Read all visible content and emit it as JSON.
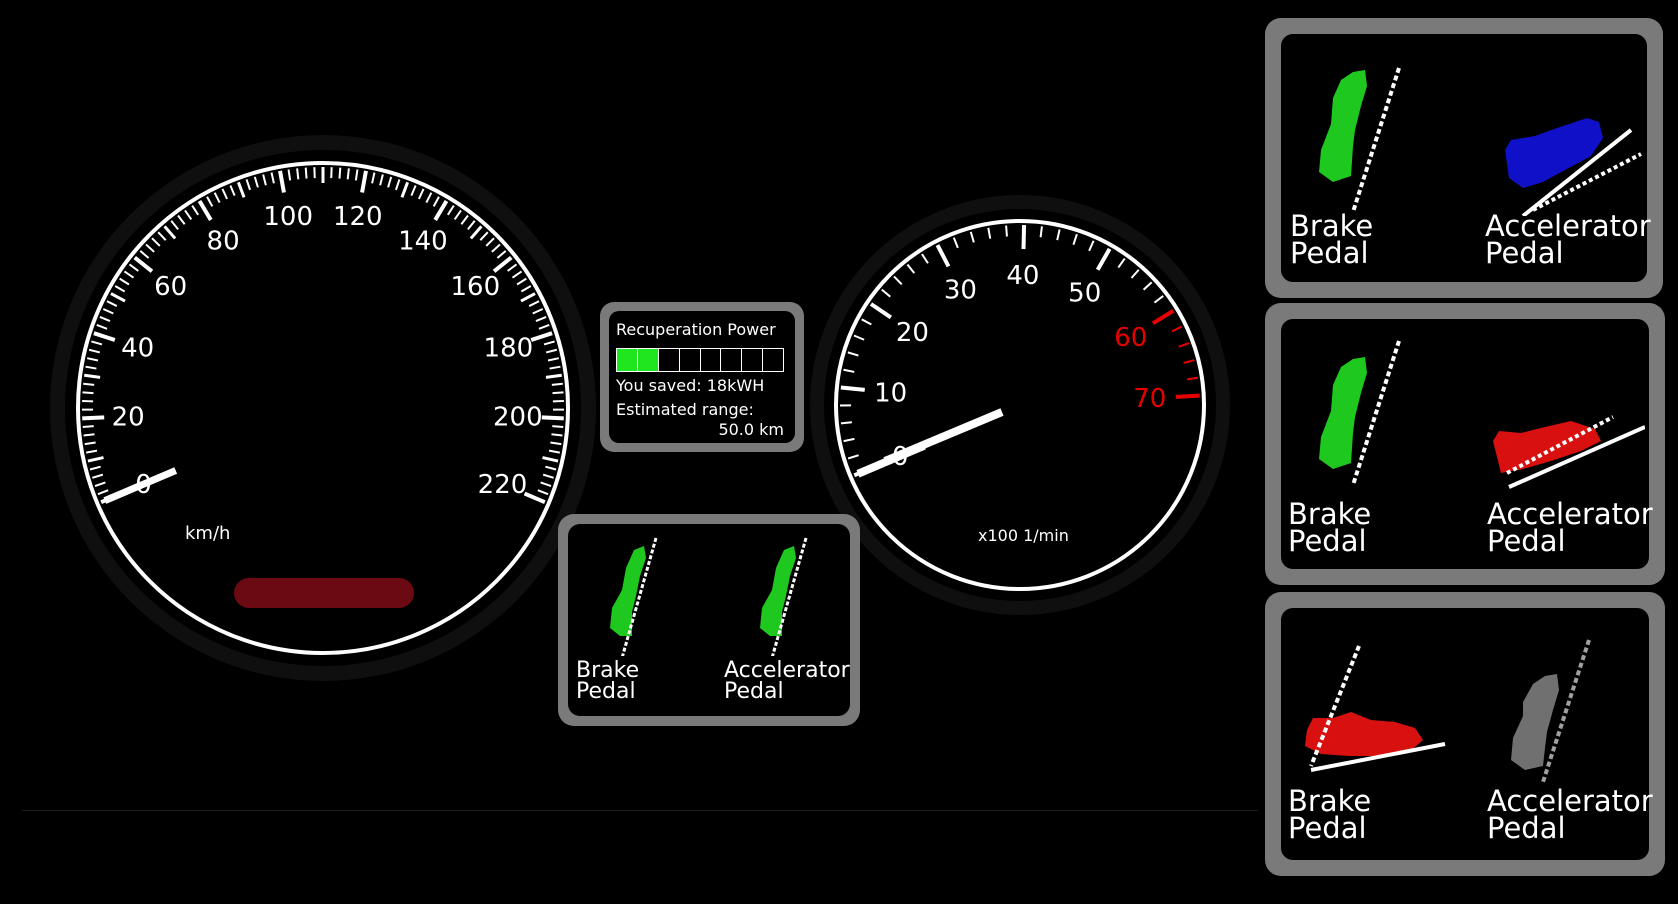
{
  "speedometer": {
    "unit": "km/h",
    "tick_labels": [
      "0",
      "20",
      "40",
      "60",
      "80",
      "100",
      "120",
      "140",
      "160",
      "180",
      "200",
      "220"
    ],
    "value": 0,
    "indicator_color": "#6b0a12"
  },
  "tachometer": {
    "unit": "x100 1/min",
    "tick_labels": [
      "0",
      "10",
      "20",
      "30",
      "40",
      "50",
      "60",
      "70"
    ],
    "redline_labels_color": "#e60000",
    "value": 0
  },
  "recuperation": {
    "title": "Recuperation Power",
    "bar_segments_total": 8,
    "bar_segments_filled": 2,
    "bar_color": "#1fe61f",
    "saved_text": "You saved: 18kWH",
    "range_label": "Estimated range:",
    "range_value": "50.0 km"
  },
  "pedal_panels": [
    {
      "brake_label": "Brake\nPedal",
      "accelerator_label": "Accelerator\nPedal",
      "brake_color": "#1ec81e",
      "accelerator_color": "#1ec81e"
    },
    {
      "brake_label": "Brake\nPedal",
      "accelerator_label": "Accelerator\nPedal",
      "brake_color": "#1ec81e",
      "accelerator_color": "#1010c8"
    },
    {
      "brake_label": "Brake\nPedal",
      "accelerator_label": "Accelerator\nPedal",
      "brake_color": "#1ec81e",
      "accelerator_color": "#d81010"
    },
    {
      "brake_label": "Brake\nPedal",
      "accelerator_label": "Accelerator\nPedal",
      "brake_color": "#d81010",
      "accelerator_color": "#707070"
    }
  ]
}
